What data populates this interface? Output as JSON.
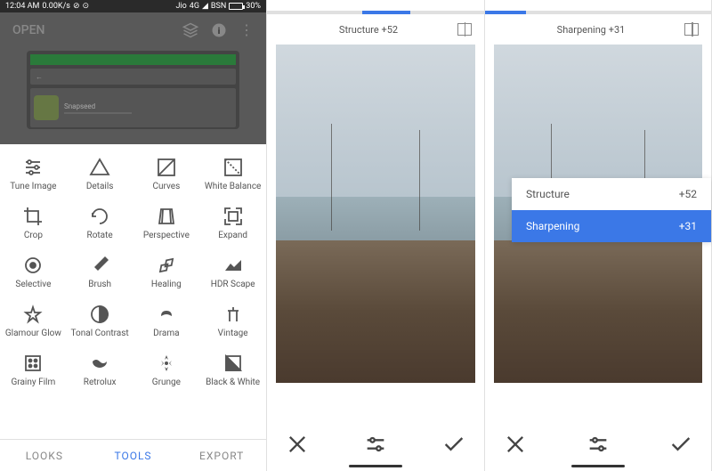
{
  "status": {
    "time": "12:04 AM",
    "speed": "0.00K/s",
    "carrier1": "Jio",
    "signal": "4G",
    "carrier2": "BSN",
    "battery": "30%"
  },
  "header": {
    "title": "OPEN",
    "app_name": "Snapseed"
  },
  "tools": [
    {
      "id": "tune-image",
      "label": "Tune Image"
    },
    {
      "id": "details",
      "label": "Details"
    },
    {
      "id": "curves",
      "label": "Curves"
    },
    {
      "id": "white-balance",
      "label": "White Balance"
    },
    {
      "id": "crop",
      "label": "Crop"
    },
    {
      "id": "rotate",
      "label": "Rotate"
    },
    {
      "id": "perspective",
      "label": "Perspective"
    },
    {
      "id": "expand",
      "label": "Expand"
    },
    {
      "id": "selective",
      "label": "Selective"
    },
    {
      "id": "brush",
      "label": "Brush"
    },
    {
      "id": "healing",
      "label": "Healing"
    },
    {
      "id": "hdr-scape",
      "label": "HDR Scape"
    },
    {
      "id": "glamour-glow",
      "label": "Glamour Glow"
    },
    {
      "id": "tonal-contrast",
      "label": "Tonal Contrast"
    },
    {
      "id": "drama",
      "label": "Drama"
    },
    {
      "id": "vintage",
      "label": "Vintage"
    },
    {
      "id": "grainy-film",
      "label": "Grainy Film"
    },
    {
      "id": "retrolux",
      "label": "Retrolux"
    },
    {
      "id": "grunge",
      "label": "Grunge"
    },
    {
      "id": "black-white",
      "label": "Black & White"
    }
  ],
  "tabs": {
    "looks": "LOOKS",
    "tools": "TOOLS",
    "export": "EXPORT"
  },
  "edit_panel_1": {
    "param_label": "Structure +52",
    "slider_start": "44%",
    "slider_width": "22%"
  },
  "edit_panel_2": {
    "param_label": "Sharpening +31",
    "slider_start": "0%",
    "slider_width": "18%",
    "overlay": [
      {
        "name": "Structure",
        "value": "+52",
        "selected": false
      },
      {
        "name": "Sharpening",
        "value": "+31",
        "selected": true
      }
    ]
  }
}
